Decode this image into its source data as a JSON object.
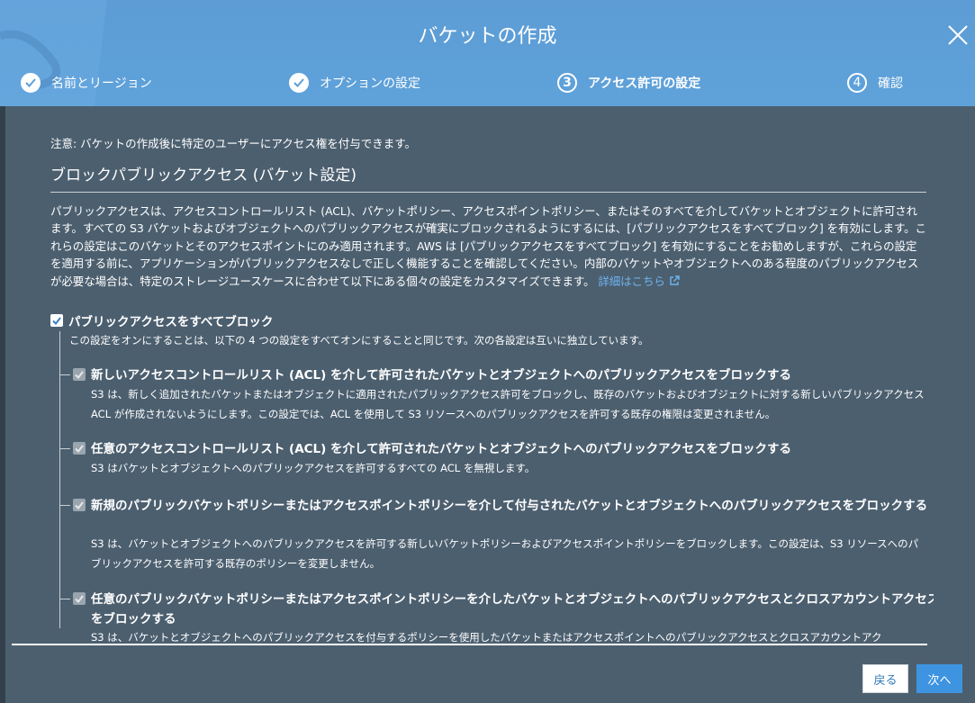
{
  "modal": {
    "title": "バケットの作成"
  },
  "steps": [
    {
      "label": "名前とリージョン",
      "status": "done",
      "marker": ""
    },
    {
      "label": "オプションの設定",
      "status": "done",
      "marker": ""
    },
    {
      "label": "アクセス許可の設定",
      "status": "active",
      "marker": "3"
    },
    {
      "label": "確認",
      "status": "pending",
      "marker": "4"
    }
  ],
  "note": "注意: バケットの作成後に特定のユーザーにアクセス権を付与できます。",
  "section_title": "ブロックパブリックアクセス (バケット設定)",
  "description": "パブリックアクセスは、アクセスコントロールリスト (ACL)、バケットポリシー、アクセスポイントポリシー、またはそのすべてを介してバケットとオブジェクトに許可されます。すべての S3 バケットおよびオブジェクトへのパブリックアクセスが確実にブロックされるようにするには、[パブリックアクセスをすべてブロック] を有効にします。これらの設定はこのバケットとそのアクセスポイントにのみ適用されます。AWS は [パブリックアクセスをすべてブロック] を有効にすることをお勧めしますが、これらの設定を適用する前に、アプリケーションがパブリックアクセスなしで正しく機能することを確認してください。内部のバケットやオブジェクトへのある程度のパブリックアクセスが必要な場合は、特定のストレージユースケースに合わせて以下にある個々の設定をカスタマイズできます。",
  "learn_more": "詳細はこちら",
  "block_all": {
    "label": "パブリックアクセスをすべてブロック",
    "checked": true,
    "description": "この設定をオンにすることは、以下の 4 つの設定をすべてオンにすることと同じです。次の各設定は互いに独立しています。"
  },
  "options": [
    {
      "label": "新しいアクセスコントロールリスト (ACL) を介して許可されたバケットとオブジェクトへのパブリックアクセスをブロックする",
      "description": "S3 は、新しく追加されたバケットまたはオブジェクトに適用されたパブリックアクセス許可をブロックし、既存のバケットおよびオブジェクトに対する新しいパブリックアクセス ACL が作成されないようにします。この設定では、ACL を使用して S3 リソースへのパブリックアクセスを許可する既存の権限は変更されません。",
      "checked": true,
      "disabled": true
    },
    {
      "label": "任意のアクセスコントロールリスト (ACL) を介して許可されたバケットとオブジェクトへのパブリックアクセスをブロックする",
      "description": "S3 はバケットとオブジェクトへのパブリックアクセスを許可するすべての ACL を無視します。",
      "checked": true,
      "disabled": true
    },
    {
      "label": "新規のパブリックバケットポリシーまたはアクセスポイントポリシーを介して付与されたバケットとオブジェクトへのパブリックアクセスをブロックする",
      "description": "S3 は、バケットとオブジェクトへのパブリックアクセスを許可する新しいバケットポリシーおよびアクセスポイントポリシーをブロックします。この設定は、S3 リソースへのパブリックアクセスを許可する既存のポリシーを変更しません。",
      "checked": true,
      "disabled": true
    },
    {
      "label": "任意のパブリックバケットポリシーまたはアクセスポイントポリシーを介したバケットとオブジェクトへのパブリックアクセスとクロスアカウントアクセスをブロックする",
      "description": "S3 は、バケットとオブジェクトへのパブリックアクセスを付与するポリシーを使用したバケットまたはアクセスポイントへのパブリックアクセスとクロスアカウントアク",
      "checked": true,
      "disabled": true
    }
  ],
  "buttons": {
    "back": "戻る",
    "next": "次へ"
  },
  "colors": {
    "header": "#5d9fd7",
    "body": "#4c5f6f",
    "link": "#6fb4f0",
    "primary_button": "#3e94e0"
  }
}
